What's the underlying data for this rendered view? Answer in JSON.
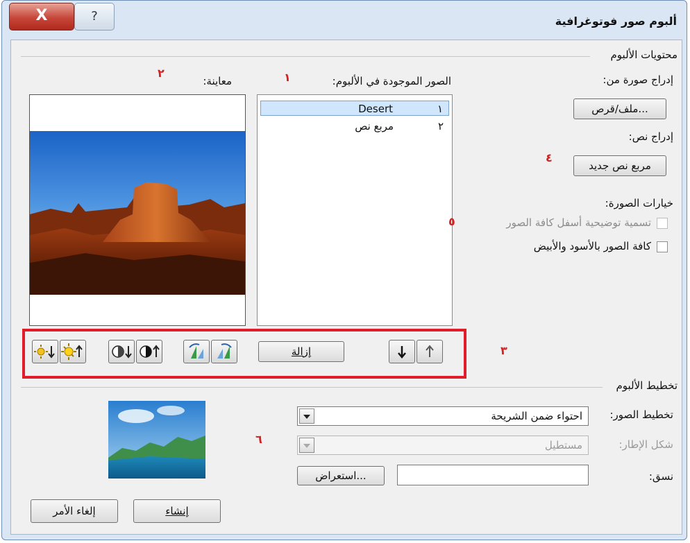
{
  "window": {
    "title": "ألبوم صور فوتوغرافية",
    "close_symbol": "X",
    "help_symbol": "?"
  },
  "contents": {
    "group_label": "محتويات الألبوم",
    "insert_picture_label": "إدراج صورة من:",
    "file_disk_button": "ملف/قرص...",
    "insert_text_label": "إدراج نص:",
    "new_textbox_button": "مربع نص جديد",
    "picture_options_label": "خيارات الصورة:",
    "options": [
      {
        "label": "تسمية توضيحية أسفل كافة الصور",
        "checked": false,
        "enabled": false
      },
      {
        "label": "كافة الصور بالأسود والأبيض",
        "checked": false,
        "enabled": true
      }
    ],
    "pictures_in_album_label": "الصور الموجودة في الألبوم:",
    "album_items": [
      {
        "index": "١",
        "name": "Desert",
        "selected": true
      },
      {
        "index": "٢",
        "name": "مربع نص",
        "selected": false
      }
    ],
    "preview_label": "معاينة:",
    "remove_button": "إزالة"
  },
  "callouts": {
    "one": "١",
    "two": "٢",
    "three": "٣",
    "four": "٤",
    "five": "٥",
    "six": "٦"
  },
  "layout_group": {
    "group_label": "تخطيط الألبوم",
    "picture_layout_label": "تخطيط الصور:",
    "picture_layout_value": "احتواء ضمن الشريحة",
    "frame_shape_label": "شكل الإطار:",
    "frame_shape_value": "مستطيل",
    "theme_label": "نسق:",
    "theme_value": "",
    "browse_button": "استعراض..."
  },
  "footer": {
    "create_button": "إنشاء",
    "cancel_button": "إلغاء الأمر"
  },
  "colors": {
    "accent_selection": "#3399ff",
    "callout_red": "#e21d2b"
  }
}
